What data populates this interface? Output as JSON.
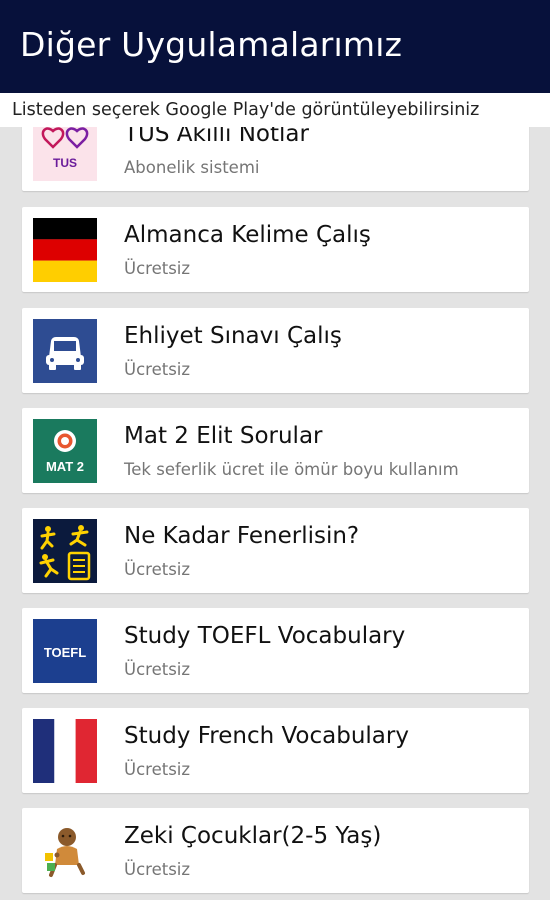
{
  "header": {
    "title": "Diğer Uygulamalarımız"
  },
  "subheader": {
    "text": "Listeden seçerek Google Play'de görüntüleyebilirsiniz"
  },
  "apps": [
    {
      "name": "TUS Akıllı Notlar",
      "price": "Abonelik sistemi",
      "icon": "tus-icon"
    },
    {
      "name": "Almanca Kelime Çalış",
      "price": "Ücretsiz",
      "icon": "german-flag-icon"
    },
    {
      "name": "Ehliyet Sınavı Çalış",
      "price": "Ücretsiz",
      "icon": "car-icon"
    },
    {
      "name": "Mat 2 Elit Sorular",
      "price": "Tek seferlik ücret ile ömür boyu kullanım",
      "icon": "mat2-icon",
      "icon_label": "MAT 2"
    },
    {
      "name": "Ne Kadar Fenerlisin?",
      "price": "Ücretsiz",
      "icon": "soccer-players-icon"
    },
    {
      "name": "Study TOEFL Vocabulary",
      "price": "Ücretsiz",
      "icon": "toefl-icon",
      "icon_label": "TOEFL"
    },
    {
      "name": "Study French Vocabulary",
      "price": "Ücretsiz",
      "icon": "french-flag-icon"
    },
    {
      "name": "Zeki Çocuklar(2-5 Yaş)",
      "price": "Ücretsiz",
      "icon": "child-icon"
    }
  ],
  "colors": {
    "appbar": "#07113b",
    "background": "#e3e3e3",
    "card": "#ffffff",
    "secondary_text": "#757575"
  }
}
